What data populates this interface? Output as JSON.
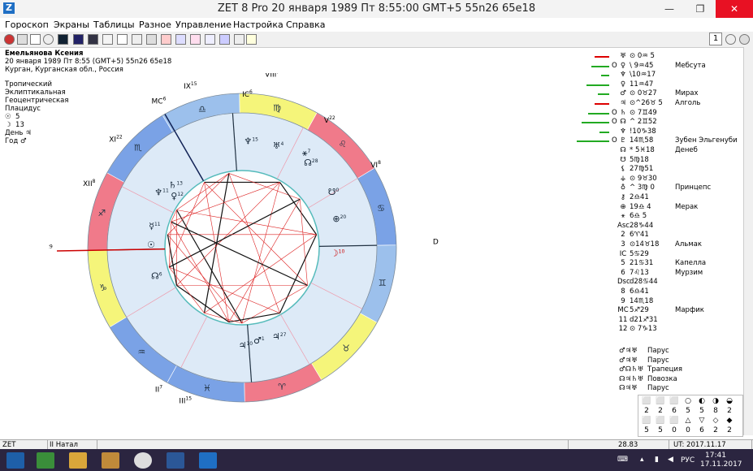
{
  "window": {
    "title": "ZET 8 Pro   20 января 1989  Пт   8:55:00 GMT+5 55n26  65e18",
    "min": "—",
    "restore": "❐",
    "close": "✕",
    "app_icon": "Z"
  },
  "menu": [
    "Гороскоп",
    "Экраны",
    "Таблицы",
    "Разное",
    "Управление",
    "Настройка",
    "Справка"
  ],
  "toolbar": {
    "page_number": "1"
  },
  "info": {
    "name": "Емельянова Ксения",
    "datetime": "20 января 1989  Пт   8:55 (GMT+5) 55n26  65e18",
    "place": "Курган, Курганская обл., Россия",
    "zodiac": "Тропический",
    "coords": "Эклиптикальная",
    "system": "Геоцентрическая",
    "houses": "Плацидус",
    "sun_val": "5",
    "moon_val": "13",
    "day": "День ♃",
    "year": "Год ♂",
    "sun_icon": "☉",
    "moon_icon": "☽"
  },
  "wheel": {
    "signs": [
      "♑",
      "♒",
      "♓",
      "♈",
      "♉",
      "♊",
      "♋",
      "♌",
      "♍",
      "♎",
      "♏",
      "♐"
    ],
    "house_labels": [
      {
        "t": "IX",
        "d": "15"
      },
      {
        "t": "VIII",
        "d": "7"
      },
      {
        "t": "MC",
        "d": "6"
      },
      {
        "t": "XI",
        "d": "22"
      },
      {
        "t": "XII",
        "d": "8"
      },
      {
        "t": "Asc",
        "d": "29"
      },
      {
        "t": "Dsc",
        "d": "29"
      },
      {
        "t": "VI",
        "d": "8"
      },
      {
        "t": "V",
        "d": "22"
      },
      {
        "t": "IC",
        "d": "6"
      },
      {
        "t": "III",
        "d": "15"
      },
      {
        "t": "II",
        "d": "7"
      }
    ],
    "planets": [
      {
        "g": "♆",
        "d": "15"
      },
      {
        "g": "♅",
        "d": "4"
      },
      {
        "g": "⚹",
        "d": "7"
      },
      {
        "g": "☊",
        "d": "28"
      },
      {
        "g": "☋",
        "d": "0"
      },
      {
        "g": "⊕",
        "d": "20"
      },
      {
        "g": "♆",
        "d": "11"
      },
      {
        "g": "♄",
        "d": "13"
      },
      {
        "g": "♀",
        "d": "12"
      },
      {
        "g": "☉",
        "d": ""
      },
      {
        "g": "☿",
        "d": "11"
      },
      {
        "g": "☊",
        "d": "6"
      },
      {
        "g": "☽",
        "d": "10"
      },
      {
        "g": "♂",
        "d": "1"
      },
      {
        "g": "♃",
        "d": "10"
      },
      {
        "g": "♃",
        "d": "27"
      }
    ]
  },
  "table": [
    {
      "bar": "#d00",
      "bw": 18,
      "orb": "",
      "gly": "♅",
      "pos": " ⊙  0♒  5",
      "star": ""
    },
    {
      "bar": "#2a2",
      "bw": 22,
      "orb": "O",
      "gly": "♀",
      "pos": " \\  9♒45",
      "star": "Мебсута"
    },
    {
      "bar": "#2a2",
      "bw": 10,
      "orb": "",
      "gly": "♆",
      "pos": "\\10♒17",
      "star": ""
    },
    {
      "bar": "#2a2",
      "bw": 28,
      "orb": "",
      "gly": "♀",
      "pos": " 11♒47",
      "star": ""
    },
    {
      "bar": "#2a2",
      "bw": 14,
      "orb": "",
      "gly": "♂",
      "pos": " ⊙  0♉27",
      "star": "Мирах"
    },
    {
      "bar": "#d00",
      "bw": 18,
      "orb": "",
      "gly": "♃",
      "pos": "⊙^26♉ 5",
      "star": "Алголь"
    },
    {
      "bar": "#2a2",
      "bw": 26,
      "orb": "O",
      "gly": "♄",
      "pos": " ⊙  7♊49",
      "star": ""
    },
    {
      "bar": "#2a2",
      "bw": 34,
      "orb": "O",
      "gly": "☊",
      "pos": " ^  2♊52",
      "star": ""
    },
    {
      "bar": "#2a2",
      "bw": 12,
      "orb": "",
      "gly": "♆",
      "pos": " !10♑38",
      "star": ""
    },
    {
      "bar": "#2a2",
      "bw": 40,
      "orb": "O",
      "gly": "♇",
      "pos": " 14♏58",
      "star": "Зубен Эльгенуби"
    },
    {
      "bar": "",
      "bw": 0,
      "orb": "",
      "gly": "☊",
      "pos": " *  5♓18",
      "star": "Денеб"
    },
    {
      "bar": "",
      "bw": 0,
      "orb": "",
      "gly": "☋",
      "pos": "  5♍18",
      "star": ""
    },
    {
      "bar": "",
      "bw": 0,
      "orb": "",
      "gly": "⚸",
      "pos": " 27♍51",
      "star": ""
    },
    {
      "bar": "",
      "bw": 0,
      "orb": "",
      "gly": "⚶",
      "pos": " ⊙  9♉30",
      "star": ""
    },
    {
      "bar": "",
      "bw": 0,
      "orb": "",
      "gly": "♁",
      "pos": " ^  3♍  0",
      "star": "Принцепс"
    },
    {
      "bar": "",
      "bw": 0,
      "orb": "",
      "gly": "⚷",
      "pos": "  2♎41",
      "star": ""
    },
    {
      "bar": "",
      "bw": 0,
      "orb": "",
      "gly": "⊕",
      "pos": " 19♎  4",
      "star": "Мерак"
    },
    {
      "bar": "",
      "bw": 0,
      "orb": "",
      "gly": "⚹",
      "pos": "  6♎  5",
      "star": ""
    },
    {
      "bar": "",
      "bw": 0,
      "orb": "",
      "gly": "Asc",
      "pos": " 28♑44",
      "star": ""
    },
    {
      "bar": "",
      "bw": 0,
      "orb": "",
      "gly": "2",
      "pos": "  6♈41",
      "star": ""
    },
    {
      "bar": "",
      "bw": 0,
      "orb": "",
      "gly": "3",
      "pos": "⊙14♉18",
      "star": "Альмак"
    },
    {
      "bar": "",
      "bw": 0,
      "orb": "",
      "gly": "IC",
      "pos": "  5♋29",
      "star": ""
    },
    {
      "bar": "",
      "bw": 0,
      "orb": "",
      "gly": "5",
      "pos": " 21♋31",
      "star": "Капелла"
    },
    {
      "bar": "",
      "bw": 0,
      "orb": "",
      "gly": "6",
      "pos": "  7♌13",
      "star": "Мурзим"
    },
    {
      "bar": "",
      "bw": 0,
      "orb": "",
      "gly": "Dsc",
      "pos": "d28♋44",
      "star": ""
    },
    {
      "bar": "",
      "bw": 0,
      "orb": "",
      "gly": "8",
      "pos": "  6♎41",
      "star": ""
    },
    {
      "bar": "",
      "bw": 0,
      "orb": "",
      "gly": "9",
      "pos": " 14♏18",
      "star": ""
    },
    {
      "bar": "",
      "bw": 0,
      "orb": "",
      "gly": "MC",
      "pos": "  5♐29",
      "star": "Марфик"
    },
    {
      "bar": "",
      "bw": 0,
      "orb": "",
      "gly": "11",
      "pos": "d21♐31",
      "star": ""
    },
    {
      "bar": "",
      "bw": 0,
      "orb": "",
      "gly": "12",
      "pos": " ⊙  7♑13",
      "star": ""
    }
  ],
  "configs": [
    {
      "g": "♂♃♅",
      "n": "Парус"
    },
    {
      "g": "♂♃♅",
      "n": "Парус"
    },
    {
      "g": "♂☊♄♅",
      "n": "Трапеция"
    },
    {
      "g": "☊♃♄♅",
      "n": "Повозка"
    },
    {
      "g": "☊♃♅",
      "n": "Парус"
    }
  ],
  "shapes": {
    "row1": [
      "⬜",
      "⬜",
      "⬜",
      "○",
      "◐",
      "◑",
      "◒"
    ],
    "row1v": [
      "2",
      "2",
      "6",
      "5",
      "5",
      "8",
      "2"
    ],
    "row2": [
      "⬜",
      "⬜",
      "⬜",
      "△",
      "▽",
      "◇",
      "◆"
    ],
    "row2v": [
      "5",
      "5",
      "0",
      "0",
      "6",
      "2",
      "2"
    ]
  },
  "status": {
    "app": "ZET",
    "mode": "II Натал",
    "coord": "28.83",
    "ut": "UT: 2017.11.17 12:41:41"
  },
  "taskbar": {
    "lang": "РУС",
    "time": "17:41",
    "date": "17.11.2017"
  }
}
